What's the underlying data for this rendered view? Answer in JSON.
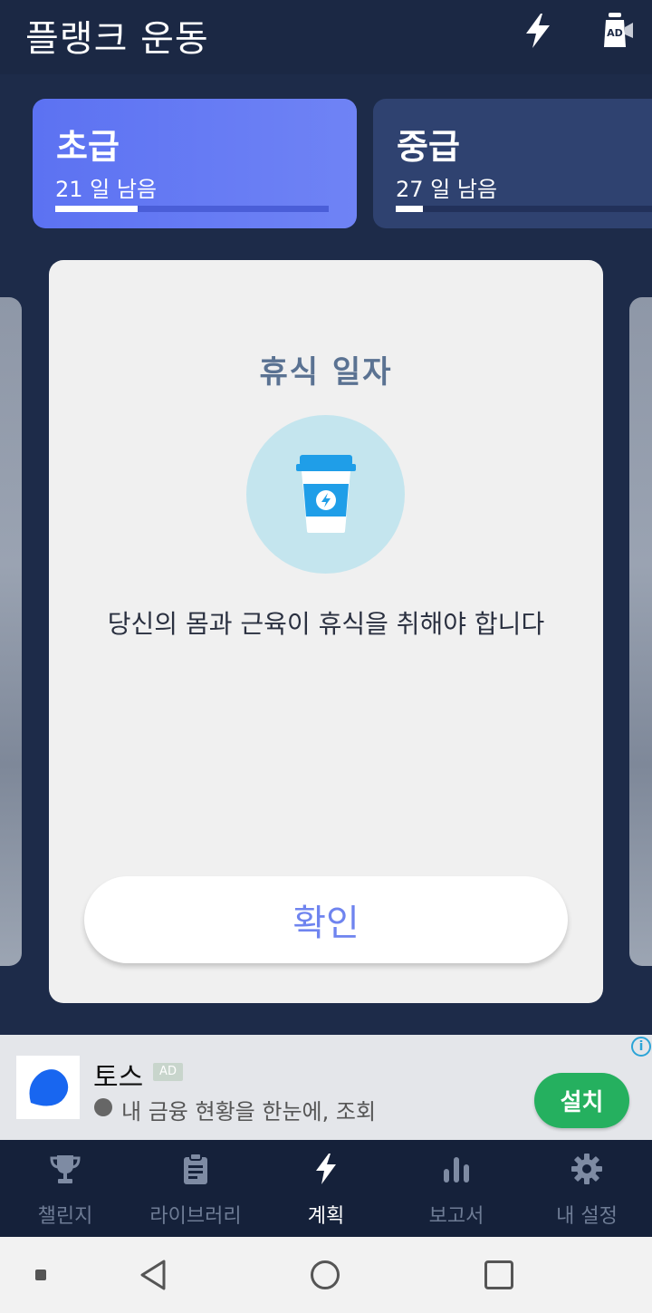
{
  "app": {
    "title": "플랭크 운동"
  },
  "top_icons": {
    "bolt": "bolt-icon",
    "ad": "ad-remove-icon"
  },
  "levels": [
    {
      "name": "초급",
      "remaining": "21 일 남음",
      "progress": 0.3
    },
    {
      "name": "중급",
      "remaining": "27 일 남음",
      "progress": 0.1
    }
  ],
  "dialog": {
    "title": "휴식 일자",
    "icon": "coffee-cup-icon",
    "message": "당신의 몸과 근육이 휴식을 취해야 합니다",
    "confirm_label": "확인"
  },
  "ad": {
    "name": "토스",
    "tag": "AD",
    "description": "내 금융 현황을 한눈에, 조회",
    "install_label": "설치",
    "info": "i"
  },
  "nav": [
    {
      "label": "챌린지",
      "icon": "trophy-icon",
      "active": false
    },
    {
      "label": "라이브러리",
      "icon": "clipboard-icon",
      "active": false
    },
    {
      "label": "계획",
      "icon": "bolt-icon",
      "active": true
    },
    {
      "label": "보고서",
      "icon": "bar-chart-icon",
      "active": false
    },
    {
      "label": "내 설정",
      "icon": "gear-icon",
      "active": false
    }
  ],
  "colors": {
    "background": "#1d2b49",
    "accent": "#6f84ef",
    "install_green": "#25b05f"
  }
}
